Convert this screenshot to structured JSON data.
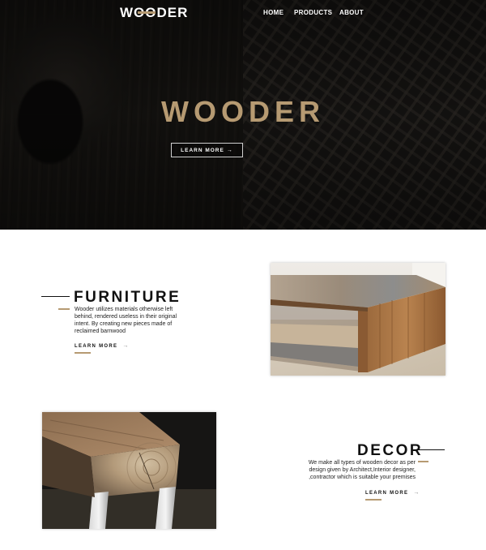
{
  "header": {
    "logo": "WOODER",
    "nav": [
      "HOME",
      "PRODUCTS",
      "ABOUT"
    ]
  },
  "hero": {
    "title": "WOODER",
    "button_label": "LEARN MORE",
    "button_arrow": "→"
  },
  "sections": [
    {
      "title": "FURNITURE",
      "text": "Wooder utilizes materials otherwise left behind, rendered useless in their original intent. By creating new pieces made of reclaimed barnwood",
      "link_label": "LEARN MORE",
      "link_arrow": "→"
    },
    {
      "title": "DECOR",
      "text": "We make all types of wooden decor as per design given by Architect,Interior designer, ,contractor which is suitable your premises",
      "link_label": "LEARN MORE",
      "link_arrow": "→"
    }
  ],
  "colors": {
    "accent": "#b69a72",
    "hero_background": "#141210",
    "text": "#111111"
  }
}
